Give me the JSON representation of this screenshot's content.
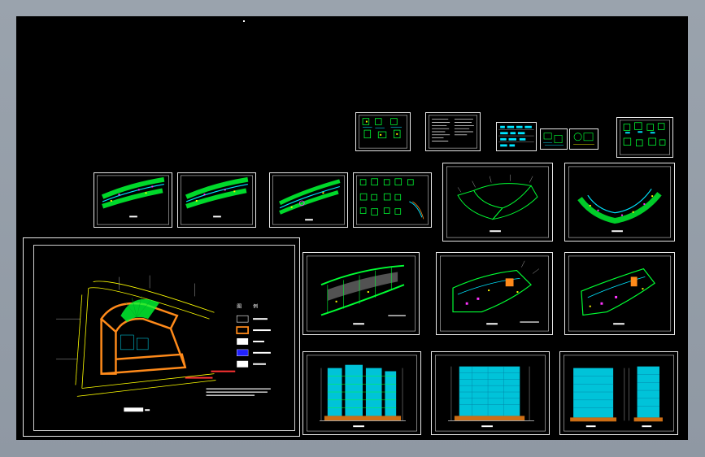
{
  "site_plan": {
    "legend": {
      "header_left": "图",
      "header_right": "例"
    }
  },
  "colors": {
    "background_frame": "#9aa3ad",
    "canvas": "#000000",
    "sheet_border": "#e8e8e8",
    "green": "#00ff33",
    "cyan": "#00e5ff",
    "yellow": "#ffff00",
    "orange": "#ff8a1a",
    "magenta": "#ff33ff"
  }
}
